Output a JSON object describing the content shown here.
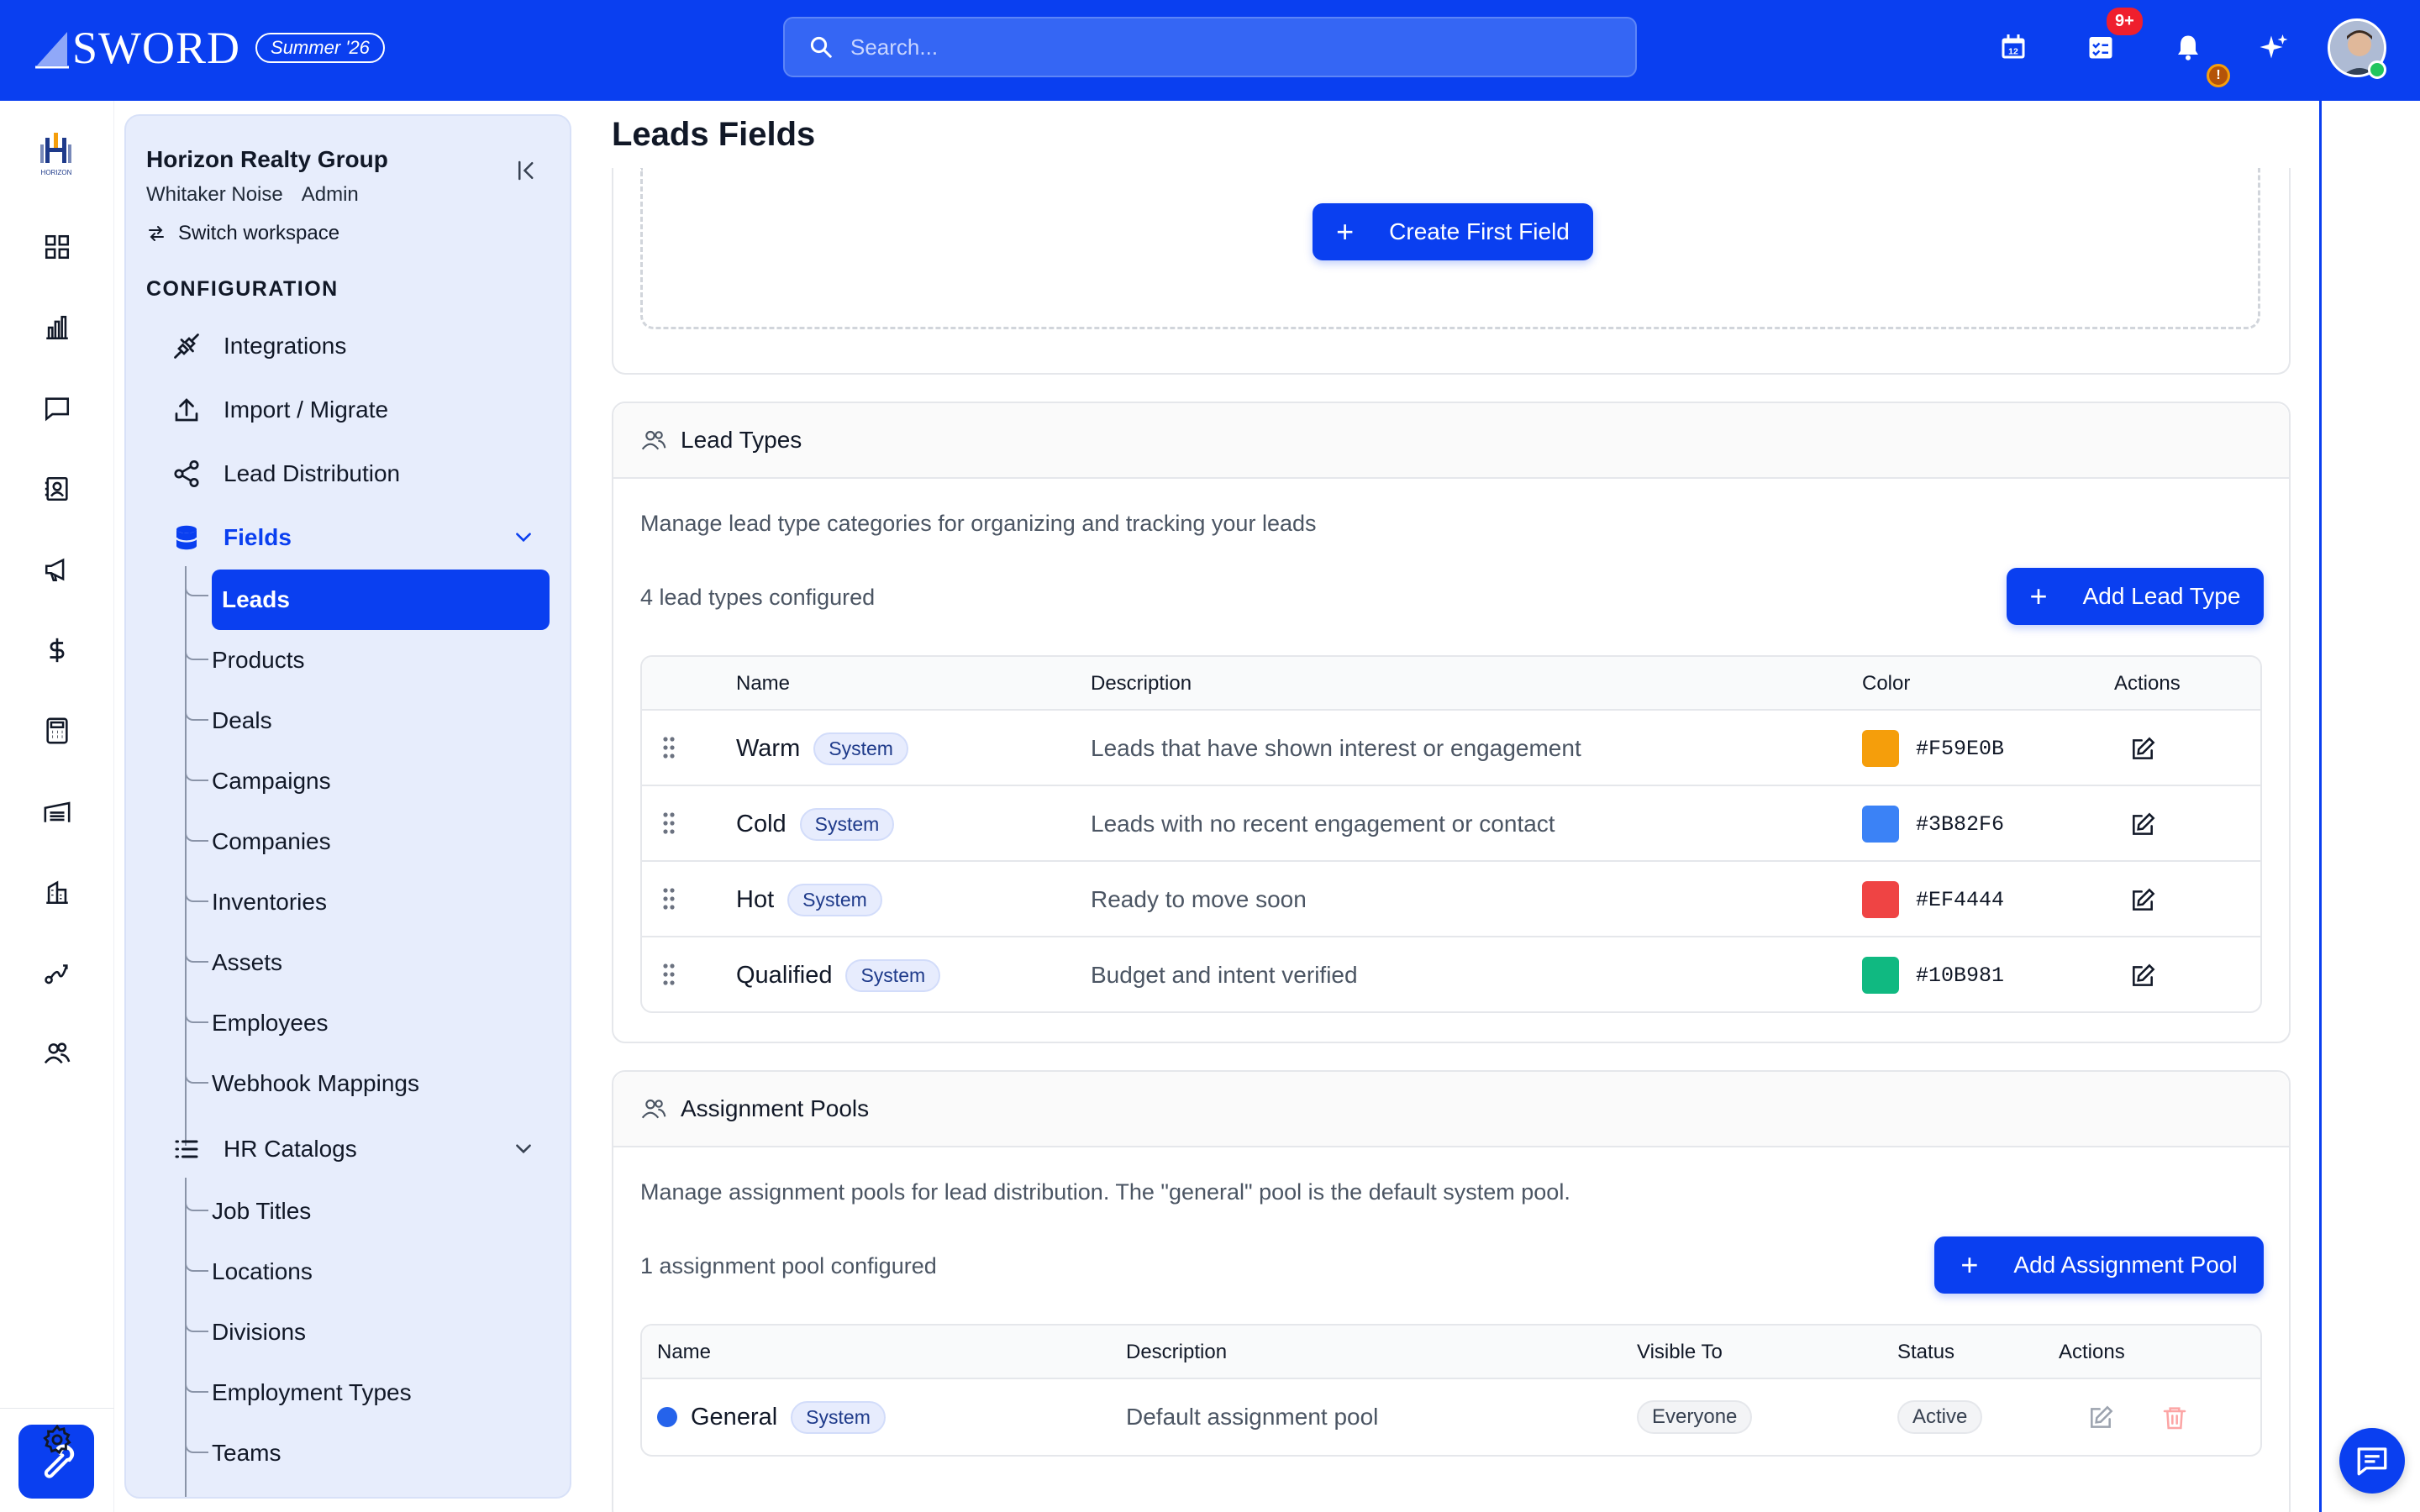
{
  "brand": {
    "name": "SWORD",
    "season": "Summer '26",
    "primary_color": "#0a3ff0"
  },
  "search": {
    "placeholder": "Search..."
  },
  "topbar": {
    "task_badge": "9+",
    "warning_badge": "!"
  },
  "rail": {
    "logo_text": "HORIZON",
    "items": [
      "dashboard-icon",
      "analytics-icon",
      "messages-icon",
      "contacts-icon",
      "campaigns-icon",
      "dollar-icon",
      "calculator-icon",
      "warehouse-icon",
      "buildings-icon",
      "routes-icon",
      "team-icon"
    ],
    "active": "wrench-icon",
    "bottom": "settings-icon"
  },
  "sidebar": {
    "org_name": "Horizon Realty Group",
    "user_name": "Whitaker Noise",
    "user_role": "Admin",
    "switch_workspace": "Switch workspace",
    "section": "CONFIGURATION",
    "items": {
      "integrations": "Integrations",
      "import": "Import / Migrate",
      "distribution": "Lead Distribution",
      "fields": "Fields",
      "hr": "HR Catalogs"
    },
    "fields_sub": [
      "Leads",
      "Products",
      "Deals",
      "Campaigns",
      "Companies",
      "Inventories",
      "Assets",
      "Employees",
      "Webhook Mappings"
    ],
    "hr_sub": [
      "Job Titles",
      "Locations",
      "Divisions",
      "Employment Types",
      "Teams"
    ]
  },
  "main": {
    "title": "Leads Fields",
    "create_first_field": "Create First Field",
    "lead_types": {
      "title": "Lead Types",
      "description": "Manage lead type categories for organizing and tracking your leads",
      "count": "4 lead types configured",
      "add_button": "Add Lead Type",
      "columns": {
        "name": "Name",
        "description": "Description",
        "color": "Color",
        "actions": "Actions"
      },
      "rows": [
        {
          "name": "Warm",
          "badge": "System",
          "description": "Leads that have shown interest or engagement",
          "color": "#F59E0B"
        },
        {
          "name": "Cold",
          "badge": "System",
          "description": "Leads with no recent engagement or contact",
          "color": "#3B82F6"
        },
        {
          "name": "Hot",
          "badge": "System",
          "description": "Ready to move soon",
          "color": "#EF4444"
        },
        {
          "name": "Qualified",
          "badge": "System",
          "description": "Budget and intent verified",
          "color": "#10B981"
        }
      ]
    },
    "pools": {
      "title": "Assignment Pools",
      "description": "Manage assignment pools for lead distribution. The \"general\" pool is the default system pool.",
      "count": "1 assignment pool configured",
      "add_button": "Add Assignment Pool",
      "columns": {
        "name": "Name",
        "description": "Description",
        "visible_to": "Visible To",
        "status": "Status",
        "actions": "Actions"
      },
      "rows": [
        {
          "name": "General",
          "badge": "System",
          "description": "Default assignment pool",
          "visible_to": "Everyone",
          "status": "Active",
          "dot_color": "#2563eb"
        }
      ]
    }
  }
}
